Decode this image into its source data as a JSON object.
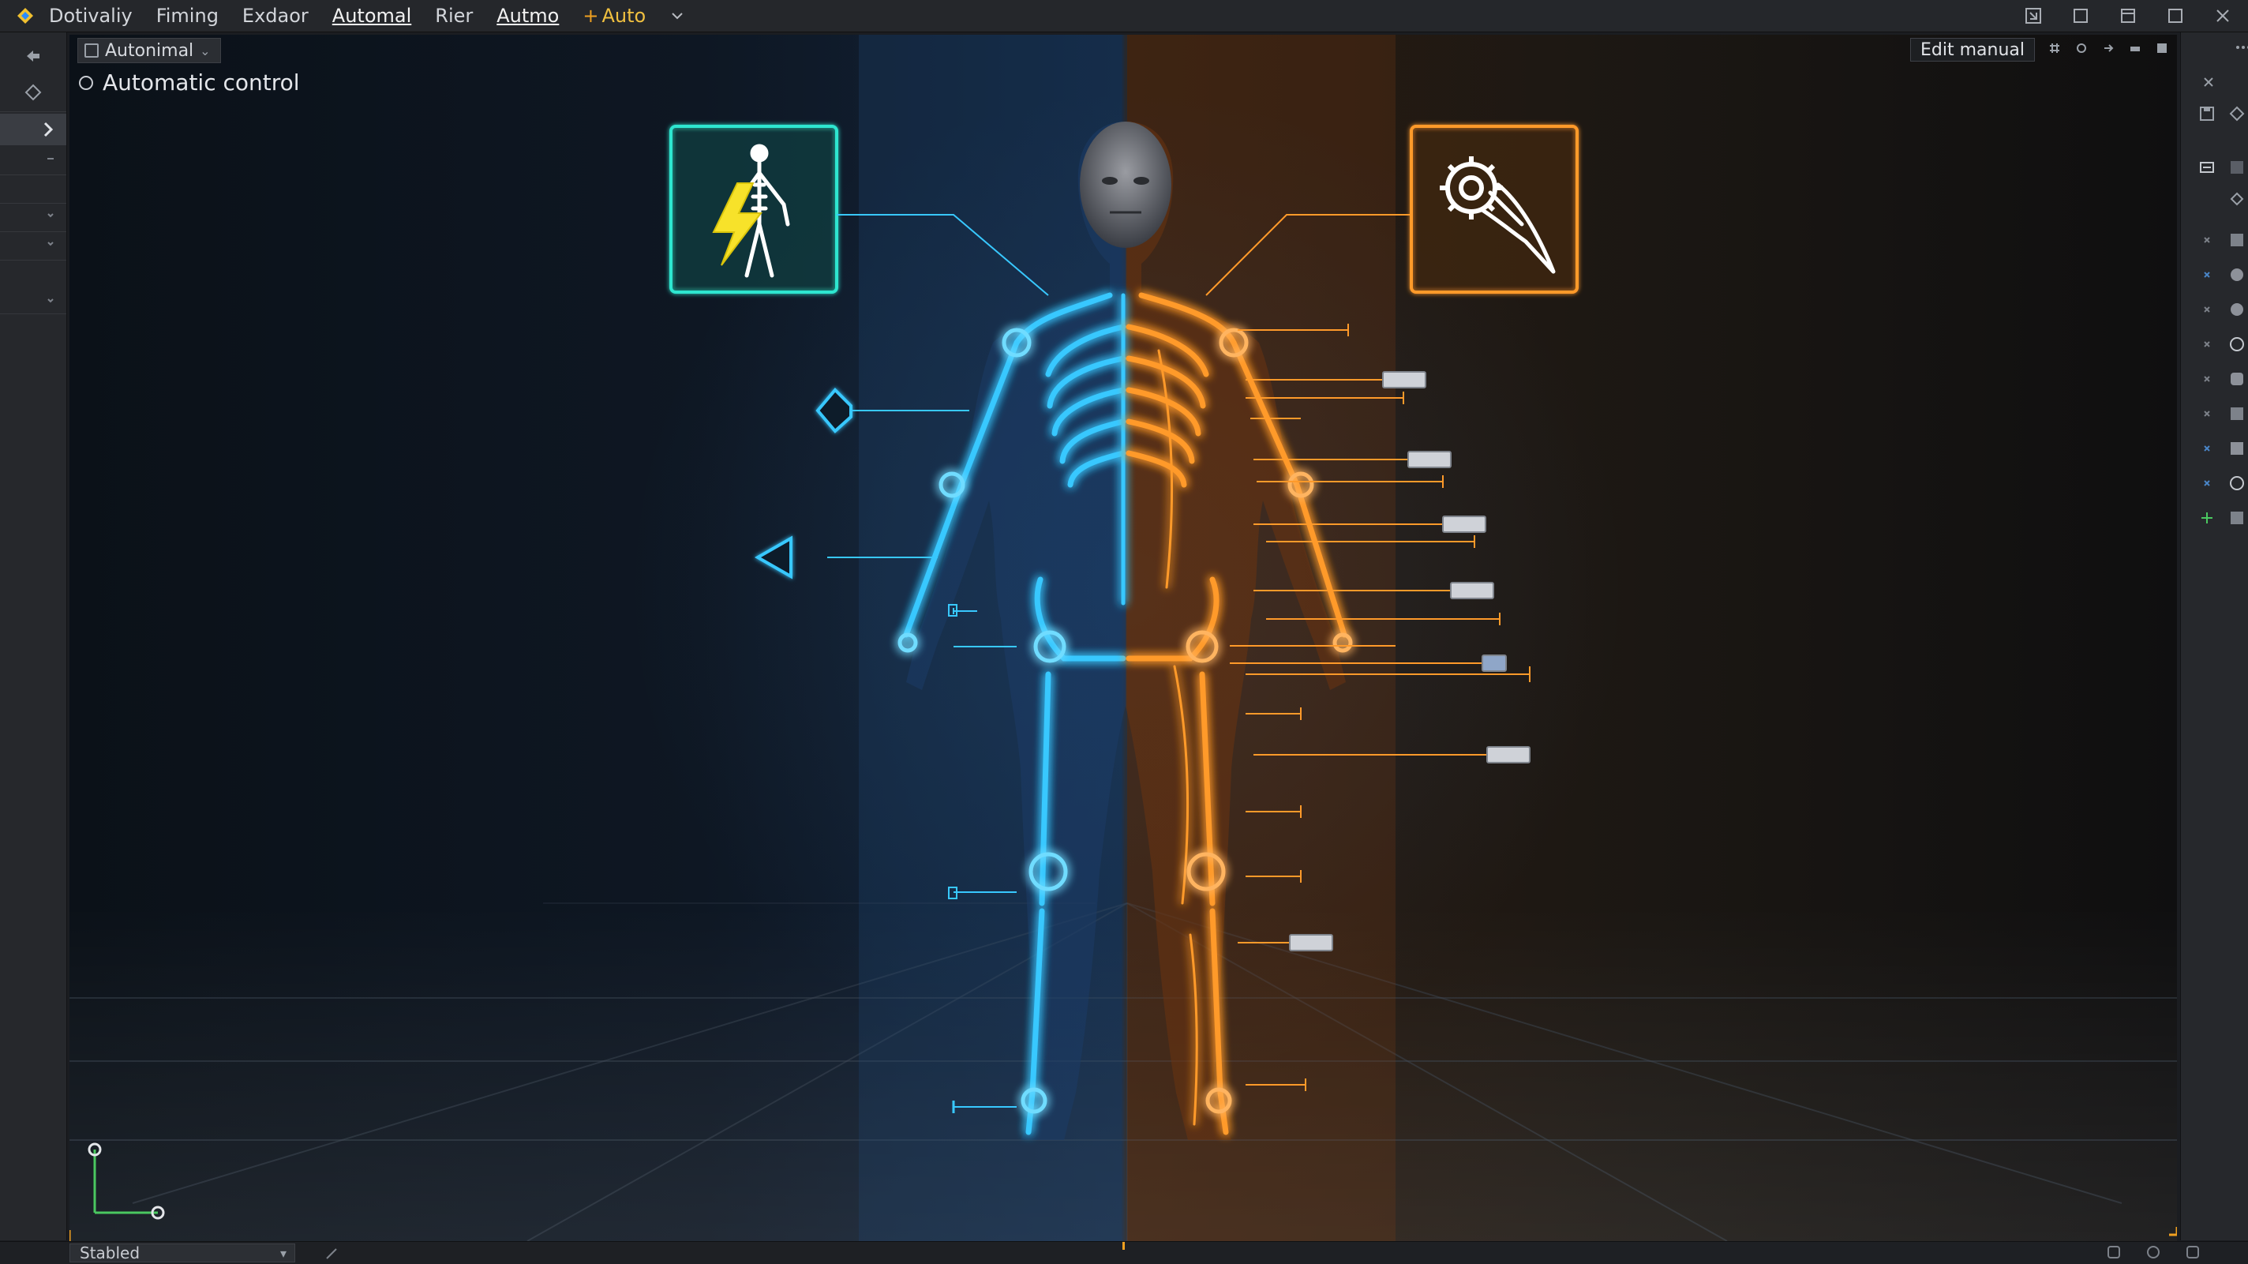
{
  "menubar": {
    "items": [
      {
        "label": "Dotivaliy"
      },
      {
        "label": "Fiming"
      },
      {
        "label": "Exdaor"
      },
      {
        "label": "Automal"
      },
      {
        "label": "Rier"
      },
      {
        "label": "Autmo"
      },
      {
        "label": "Auto"
      }
    ],
    "plus_glyph": "+"
  },
  "viewport": {
    "mode_tab": "Autonimal",
    "mode_label": "Automatic control",
    "edit_button": "Edit manual"
  },
  "statusbar": {
    "dropdown_value": "Stabled"
  },
  "colors": {
    "accent_blue": "#38c8ff",
    "accent_orange": "#ff9a2a",
    "teal": "#2ee6d0",
    "bolt_yellow": "#f7e22a"
  }
}
